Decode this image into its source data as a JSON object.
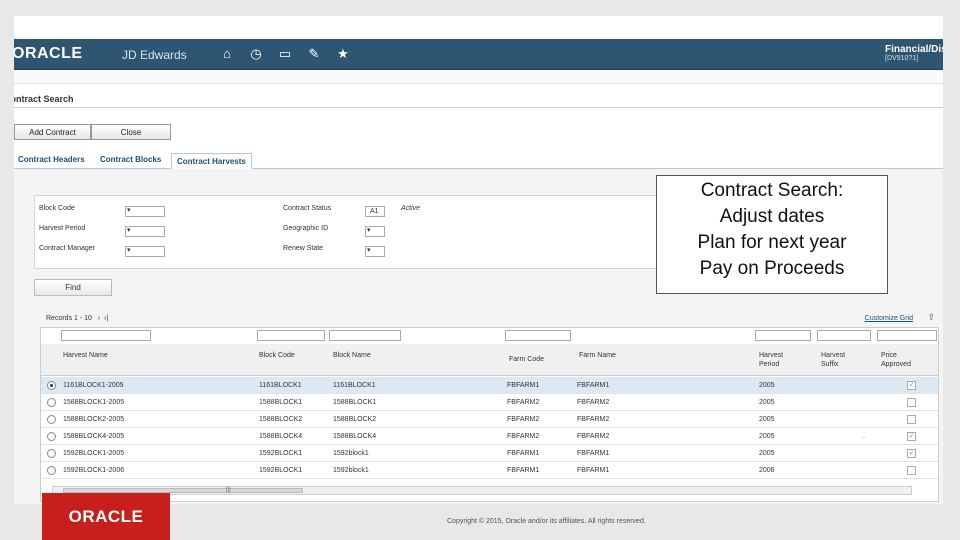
{
  "header": {
    "logo": "ORACLE",
    "product": "JD Edwards",
    "nav_icons": [
      "home-icon",
      "recent-icon",
      "chart-icon",
      "edit-icon",
      "favorites-icon"
    ],
    "context_title": "Financial/Dis",
    "context_sub": "[DV910?1]"
  },
  "app": {
    "dropdown_glyph": "▾",
    "title": "Contract Search",
    "buttons": {
      "add": "Add Contract",
      "close": "Close"
    },
    "tabs": [
      "Contract Headers",
      "Contract Blocks",
      "Contract Harvests"
    ]
  },
  "filters": {
    "block_code_label": "Block Code",
    "harvest_period_label": "Harvest Period",
    "contract_manager_label": "Contract Manager",
    "contract_status_label": "Contract Status",
    "contract_status_value": "A1",
    "contract_status_desc": "Active",
    "geographic_label": "Geographic ID",
    "renew_state_label": "Renew State",
    "find_label": "Find"
  },
  "grid": {
    "records_text": "Records 1 - 10",
    "customize_label": "Customize Grid",
    "columns": [
      "Harvest Name",
      "Block Code",
      "Block Name",
      "Farm Code",
      "Farm Name",
      "Harvest Period",
      "Harvest Suffix",
      "Price Approved"
    ],
    "rows": [
      {
        "name": "1161BLOCK1-2005",
        "block_code": "1161BLOCK1",
        "block_name": "1161BLOCK1",
        "farm_code": "FBFARM1",
        "farm_name": "FBFARM1",
        "period": "2005",
        "suffix": "",
        "approved": "✓"
      },
      {
        "name": "1588BLOCK1-2005",
        "block_code": "1588BLOCK1",
        "block_name": "1588BLOCK1",
        "farm_code": "FBFARM2",
        "farm_name": "FBFARM2",
        "period": "2005",
        "suffix": "",
        "approved": ""
      },
      {
        "name": "1588BLOCK2-2005",
        "block_code": "1588BLOCK2",
        "block_name": "1588BLOCK2",
        "farm_code": "FBFARM2",
        "farm_name": "FBFARM2",
        "period": "2005",
        "suffix": "",
        "approved": ""
      },
      {
        "name": "1588BLOCK4-2005",
        "block_code": "1588BLOCK4",
        "block_name": "1588BLOCK4",
        "farm_code": "FBFARM2",
        "farm_name": "FBFARM2",
        "period": "2005",
        "suffix": ".",
        "approved": "✓"
      },
      {
        "name": "1592BLOCK1-2005",
        "block_code": "1592BLOCK1",
        "block_name": "1592block1",
        "farm_code": "FBFARM1",
        "farm_name": "FBFARM1",
        "period": "2005",
        "suffix": "",
        "approved": "✓"
      },
      {
        "name": "1592BLOCK1-2006",
        "block_code": "1592BLOCK1",
        "block_name": "1592block1",
        "farm_code": "FBFARM1",
        "farm_name": "FBFARM1",
        "period": "2006",
        "suffix": "",
        "approved": ""
      }
    ]
  },
  "callout": [
    "Contract Search:",
    "Adjust dates",
    "Plan for next year",
    "Pay on Proceeds"
  ],
  "footer": {
    "logo": "ORACLE",
    "copyright": "Copyright © 2015, Oracle and/or its affiliates. All rights reserved."
  }
}
